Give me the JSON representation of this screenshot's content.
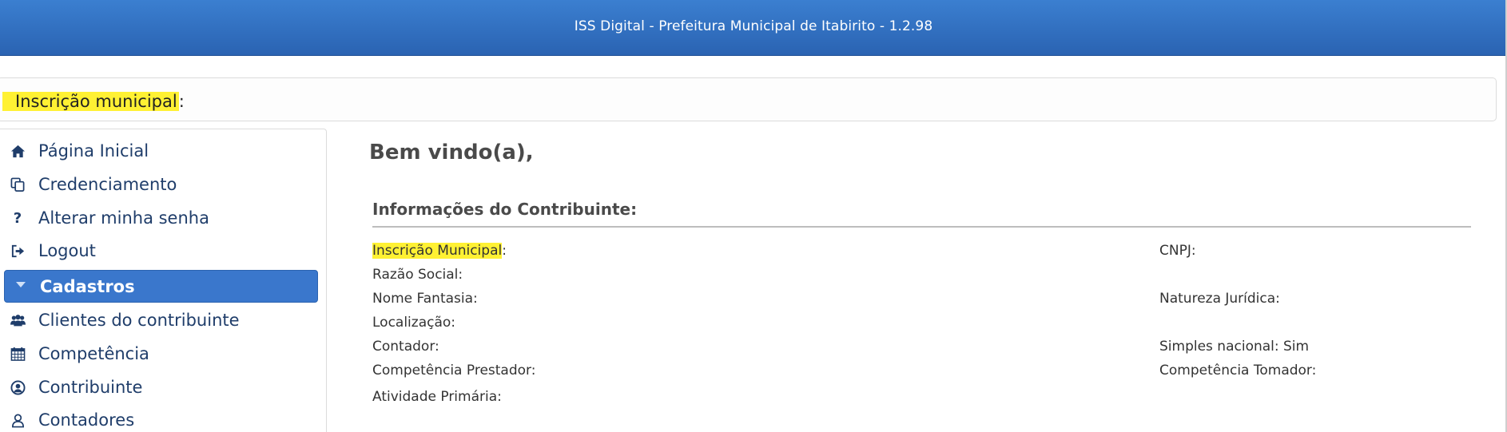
{
  "header": {
    "title": "ISS Digital - Prefeitura Municipal de Itabirito - 1.2.98"
  },
  "inscricao_bar": {
    "label": "Inscrição municipal",
    "suffix": ":"
  },
  "sidebar": {
    "items": [
      {
        "label": "Página Inicial",
        "icon": "home-icon"
      },
      {
        "label": "Credenciamento",
        "icon": "copy-icon"
      },
      {
        "label": "Alterar minha senha",
        "icon": "question-icon"
      },
      {
        "label": "Logout",
        "icon": "sign-out-icon"
      },
      {
        "label": "Cadastros",
        "icon": "caret-down-icon",
        "active": true
      },
      {
        "label": "Clientes do contribuinte",
        "icon": "users-icon"
      },
      {
        "label": "Competência",
        "icon": "calendar-icon"
      },
      {
        "label": "Contribuinte",
        "icon": "user-circle-icon"
      },
      {
        "label": "Contadores",
        "icon": "user-icon"
      }
    ]
  },
  "main": {
    "welcome": "Bem vindo(a),",
    "info_title": "Informações do Contribuinte:",
    "left_fields": {
      "inscricao": {
        "label": "Inscrição Municipal",
        "suffix": ":"
      },
      "razao_social": "Razão Social:",
      "nome_fantasia": "Nome Fantasia:",
      "localizacao": "Localização:",
      "contador": "Contador:",
      "competencia_prestador": "Competência Prestador:",
      "atividade_primaria": "Atividade Primária:"
    },
    "right_fields": {
      "cnpj": "CNPJ:",
      "natureza_juridica": "Natureza Jurídica:",
      "simples_nacional": "Simples nacional: Sim",
      "competencia_tomador": "Competência Tomador:"
    }
  },
  "colors": {
    "header": "#2f6cc0",
    "highlight": "#fff133",
    "active_nav": "#3a77cc",
    "nav_text": "#1f3d6a"
  }
}
